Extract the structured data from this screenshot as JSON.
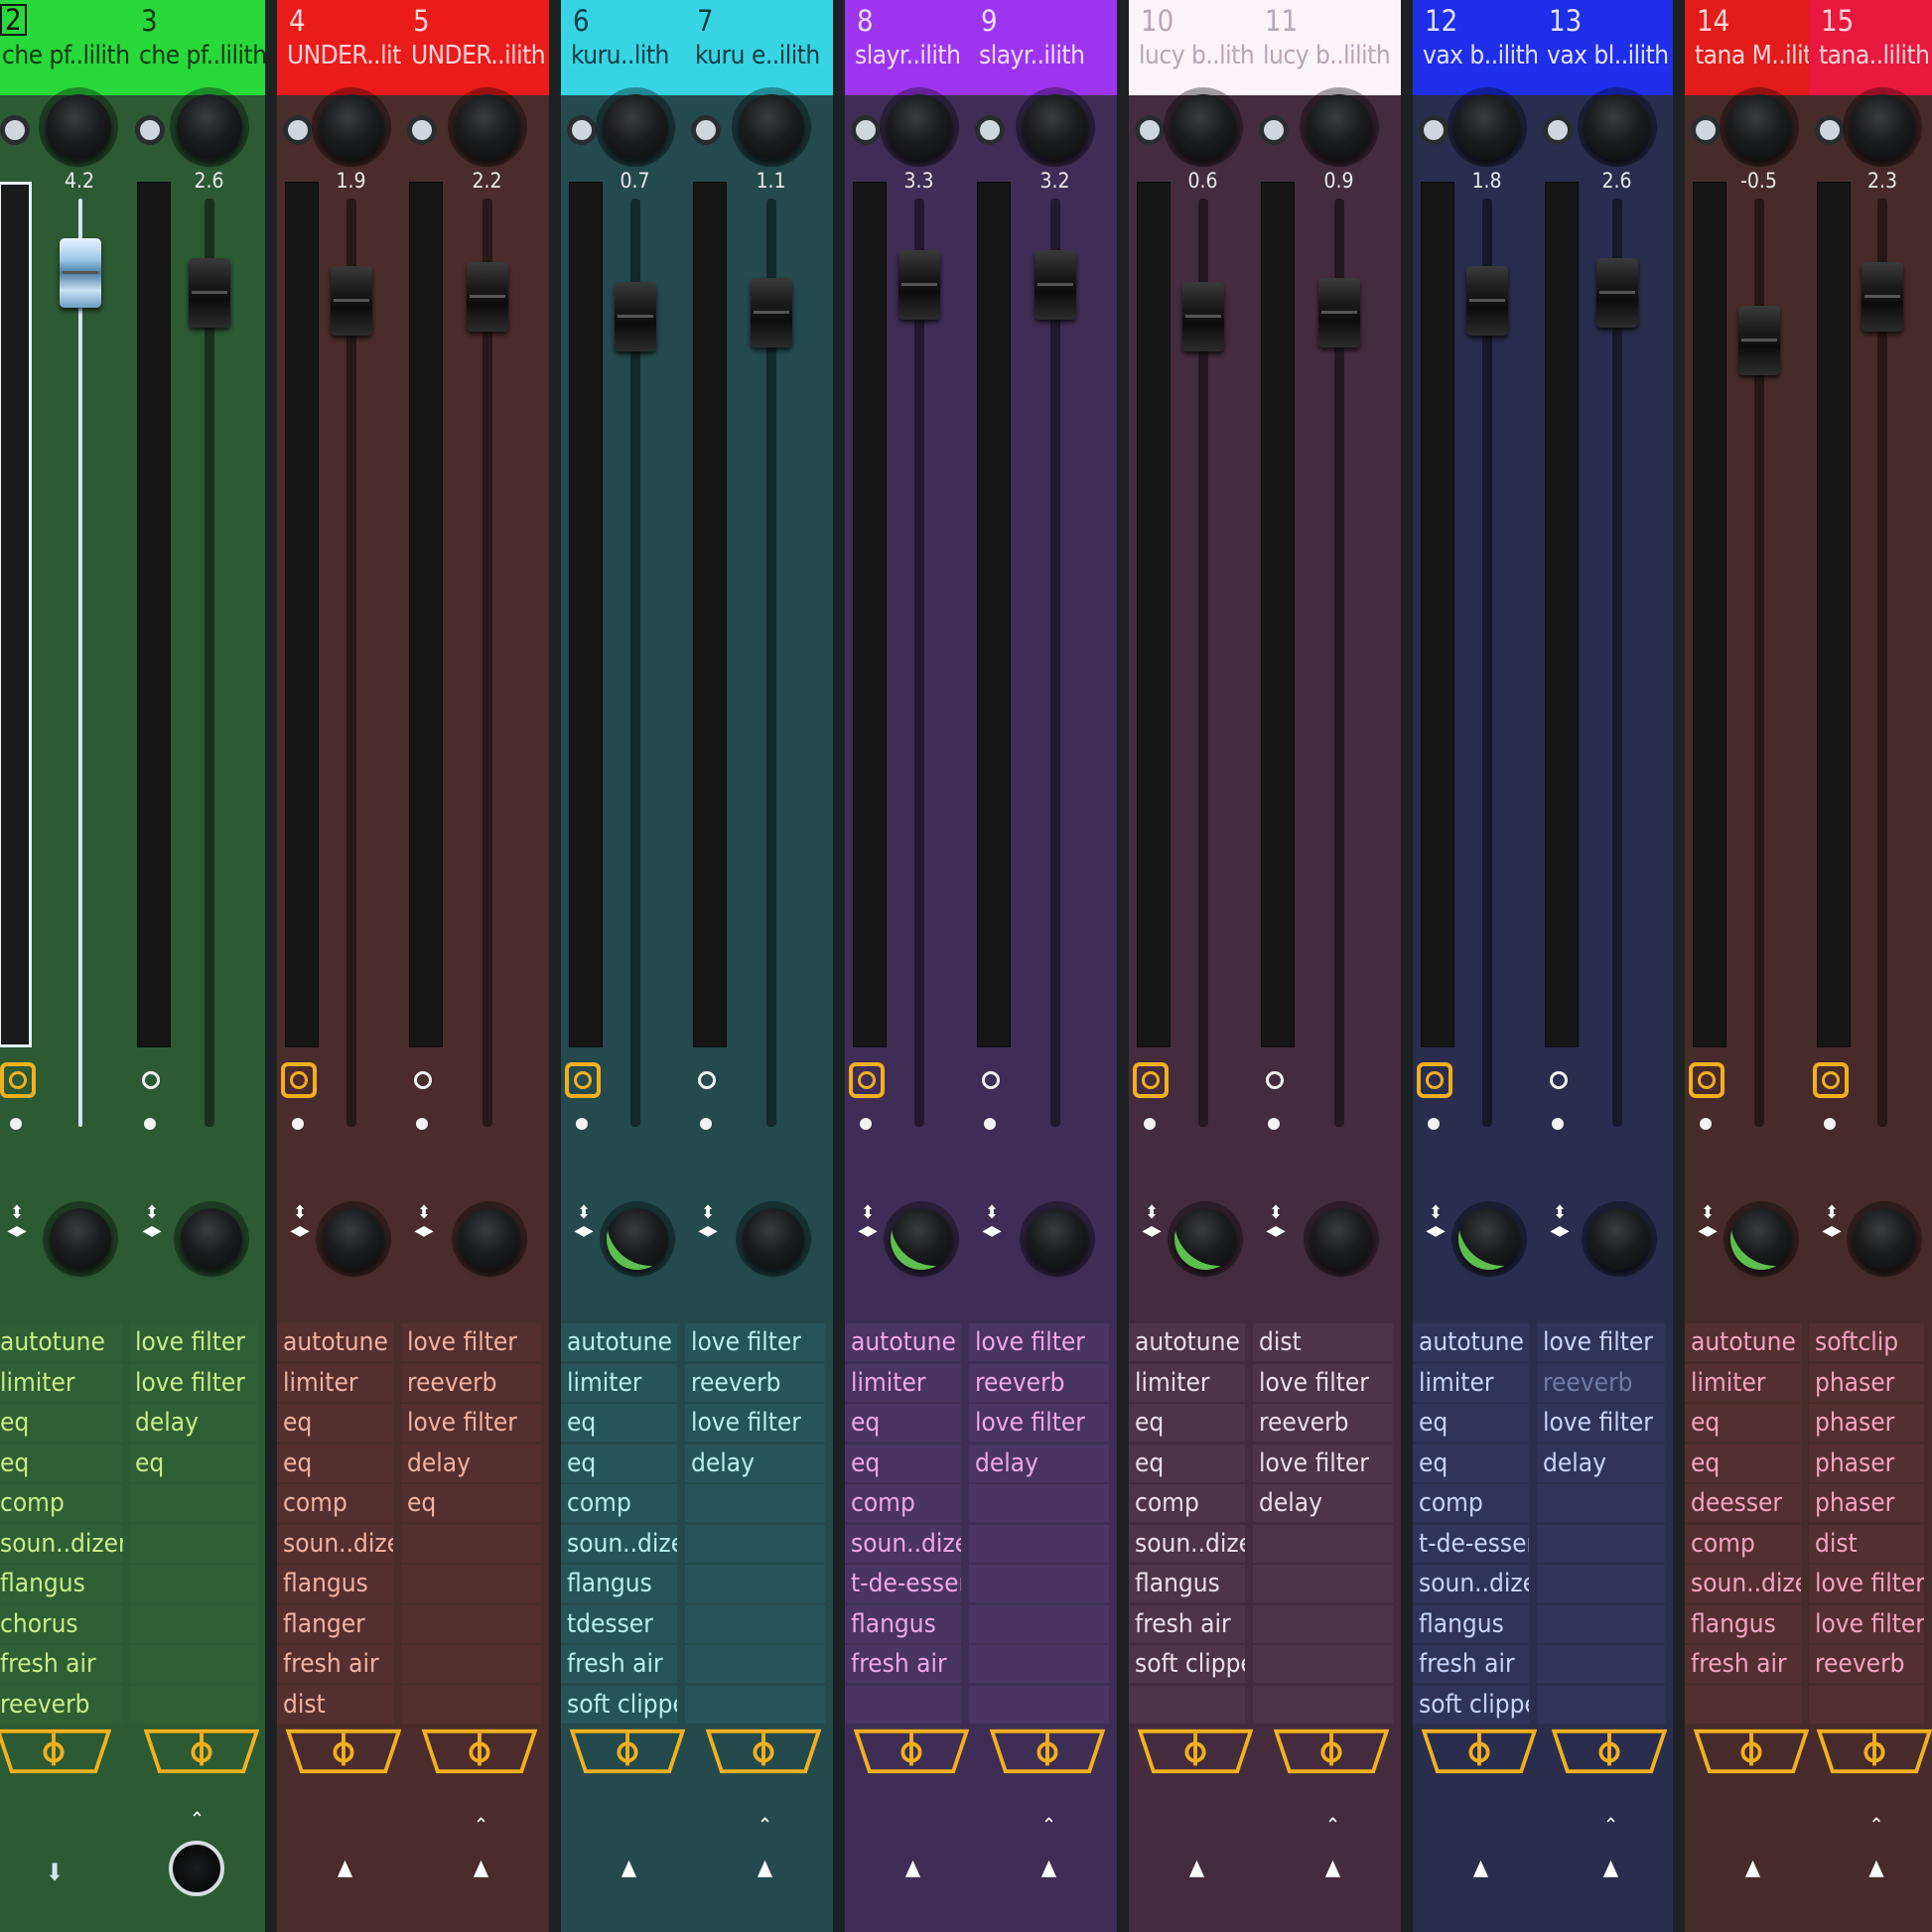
{
  "mixer": {
    "tracks": [
      {
        "num": "2",
        "name": "che pf..lilith",
        "vol": "4.2",
        "header_color": "#29d83a",
        "header_text": "#0c3a10",
        "body_color": "#2c5a33",
        "fx_color": "#c8ee8a",
        "row_tint": "#2f5f34",
        "fx": [
          "autotune",
          "limiter",
          "eq",
          "eq",
          "comp",
          "soun..dizer",
          "flangus",
          "chorus",
          "fresh air",
          "reeverb"
        ],
        "fader_pos": 0.05,
        "selected": true,
        "clock_on": true,
        "pan_ring": false,
        "bottom": "knob-down"
      },
      {
        "num": "3",
        "name": "che pf..lilith",
        "vol": "2.6",
        "header_color": "#29d83a",
        "header_text": "#0c3a10",
        "body_color": "#2c5a33",
        "fx_color": "#c8ee8a",
        "row_tint": "#2f5f34",
        "fx": [
          "love filter",
          "love filter",
          "delay",
          "eq"
        ],
        "fader_pos": 0.1,
        "selected": false,
        "clock_on": false,
        "pan_ring": false,
        "bottom": "knob-up"
      },
      {
        "num": "4",
        "name": "UNDER..lith",
        "vol": "1.9",
        "header_color": "#ea1b1b",
        "header_text": "#ffd6d6",
        "body_color": "#4a2c2c",
        "fx_color": "#f1b3a0",
        "row_tint": "#552f2f",
        "fx": [
          "autotune",
          "limiter",
          "eq",
          "eq",
          "comp",
          "soun..dizer",
          "flangus",
          "flanger",
          "fresh air",
          "dist"
        ],
        "fader_pos": 0.12,
        "selected": false,
        "clock_on": true,
        "pan_ring": false,
        "bottom": "up"
      },
      {
        "num": "5",
        "name": "UNDER..ilith",
        "vol": "2.2",
        "header_color": "#ea1b1b",
        "header_text": "#ffd6d6",
        "body_color": "#4a2c2c",
        "fx_color": "#f1b3a0",
        "row_tint": "#552f2f",
        "fx": [
          "love filter",
          "reeverb",
          "love filter",
          "delay",
          "eq"
        ],
        "fader_pos": 0.11,
        "selected": false,
        "clock_on": false,
        "pan_ring": false,
        "bottom": "up2"
      },
      {
        "num": "6",
        "name": "kuru..lith",
        "vol": "0.7",
        "header_color": "#37d4e4",
        "header_text": "#0c3e47",
        "body_color": "#244a4e",
        "fx_color": "#b8eef0",
        "row_tint": "#27545a",
        "fx": [
          "autotune",
          "limiter",
          "eq",
          "eq",
          "comp",
          "soun..dizer",
          "flangus",
          "tdesser",
          "fresh air",
          "soft clipper"
        ],
        "fader_pos": 0.16,
        "selected": false,
        "clock_on": true,
        "pan_ring": true,
        "bottom": "up"
      },
      {
        "num": "7",
        "name": "kuru e..ilith",
        "vol": "1.1",
        "header_color": "#37d4e4",
        "header_text": "#0c3e47",
        "body_color": "#244a4e",
        "fx_color": "#b8eef0",
        "row_tint": "#27545a",
        "fx": [
          "love filter",
          "reeverb",
          "love filter",
          "delay"
        ],
        "fader_pos": 0.15,
        "selected": false,
        "clock_on": false,
        "pan_ring": false,
        "bottom": "up2"
      },
      {
        "num": "8",
        "name": "slayr..ilith",
        "vol": "3.3",
        "header_color": "#9d35f0",
        "header_text": "#f0dcff",
        "body_color": "#3e2e55",
        "fx_color": "#f0a6ee",
        "row_tint": "#493463",
        "fx": [
          "autotune",
          "limiter",
          "eq",
          "eq",
          "comp",
          "soun..dizer",
          "t-de-esser",
          "flangus",
          "fresh air"
        ],
        "fader_pos": 0.08,
        "selected": false,
        "clock_on": true,
        "pan_ring": true,
        "bottom": "up"
      },
      {
        "num": "9",
        "name": "slayr..ilith",
        "vol": "3.2",
        "header_color": "#9d35f0",
        "header_text": "#f0dcff",
        "body_color": "#3e2e55",
        "fx_color": "#f0a6ee",
        "row_tint": "#493463",
        "fx": [
          "love filter",
          "reeverb",
          "love filter",
          "delay"
        ],
        "fader_pos": 0.08,
        "selected": false,
        "clock_on": false,
        "pan_ring": false,
        "bottom": "up2"
      },
      {
        "num": "10",
        "name": "lucy b..lith",
        "vol": "0.6",
        "header_color": "#faf3f7",
        "header_text": "#b9a6b7",
        "body_color": "#452c3d",
        "fx_color": "#eae0e7",
        "row_tint": "#4f3346",
        "fx": [
          "autotune",
          "limiter",
          "eq",
          "eq",
          "comp",
          "soun..dizer",
          "flangus",
          "fresh air",
          "soft clipper"
        ],
        "fader_pos": 0.16,
        "selected": false,
        "clock_on": true,
        "pan_ring": true,
        "bottom": "up"
      },
      {
        "num": "11",
        "name": "lucy b..lilith",
        "vol": "0.9",
        "header_color": "#faf3f7",
        "header_text": "#b9a6b7",
        "body_color": "#452c3d",
        "fx_color": "#eae0e7",
        "row_tint": "#4f3346",
        "fx": [
          "dist",
          "love filter",
          "reeverb",
          "love filter",
          "delay"
        ],
        "fader_pos": 0.15,
        "selected": false,
        "clock_on": false,
        "pan_ring": false,
        "bottom": "up2"
      },
      {
        "num": "12",
        "name": "vax b..ilith",
        "vol": "1.8",
        "header_color": "#1f2ee8",
        "header_text": "#dfe3ff",
        "body_color": "#2a2d4e",
        "fx_color": "#c7d4ff",
        "row_tint": "#30345b",
        "fx": [
          "autotune",
          "limiter",
          "eq",
          "eq",
          "comp",
          "t-de-esser",
          "soun..dizer",
          "flangus",
          "fresh air",
          "soft clipper"
        ],
        "fader_pos": 0.12,
        "selected": false,
        "clock_on": true,
        "pan_ring": true,
        "bottom": "up"
      },
      {
        "num": "13",
        "name": "vax bl..ilith",
        "vol": "2.6",
        "header_color": "#1f2ee8",
        "header_text": "#dfe3ff",
        "body_color": "#2a2d4e",
        "fx_color": "#c7d4ff",
        "row_tint": "#30345b",
        "fx": [
          "love filter",
          "reeverb",
          "love filter",
          "delay"
        ],
        "fx_dim": [
          1
        ],
        "fader_pos": 0.1,
        "selected": false,
        "clock_on": false,
        "pan_ring": false,
        "bottom": "up2"
      },
      {
        "num": "14",
        "name": "tana M..ilith",
        "vol": "-0.5",
        "header_color": "#e21b1b",
        "header_text": "#ffd6d6",
        "body_color": "#472b2b",
        "fx_color": "#f3a3c4",
        "row_tint": "#542f31",
        "fx": [
          "autotune",
          "limiter",
          "eq",
          "eq",
          "deesser",
          "comp",
          "soun..dizer",
          "flangus",
          "fresh air"
        ],
        "fader_pos": 0.22,
        "selected": false,
        "clock_on": true,
        "pan_ring": true,
        "bottom": "up"
      },
      {
        "num": "15",
        "name": "tana..lilith",
        "vol": "2.3",
        "header_color": "#e8183e",
        "header_text": "#ffd6d6",
        "body_color": "#472b2b",
        "fx_color": "#f3a3c4",
        "row_tint": "#542f31",
        "fx": [
          "softclip",
          "phaser",
          "phaser",
          "phaser",
          "phaser",
          "dist",
          "love filter",
          "love filter",
          "reeverb"
        ],
        "fader_pos": 0.11,
        "selected": false,
        "clock_on": true,
        "pan_ring": false,
        "bottom": "up2"
      }
    ],
    "colors": {
      "gap": "#1d2124",
      "gold": "#f2b01e"
    }
  }
}
